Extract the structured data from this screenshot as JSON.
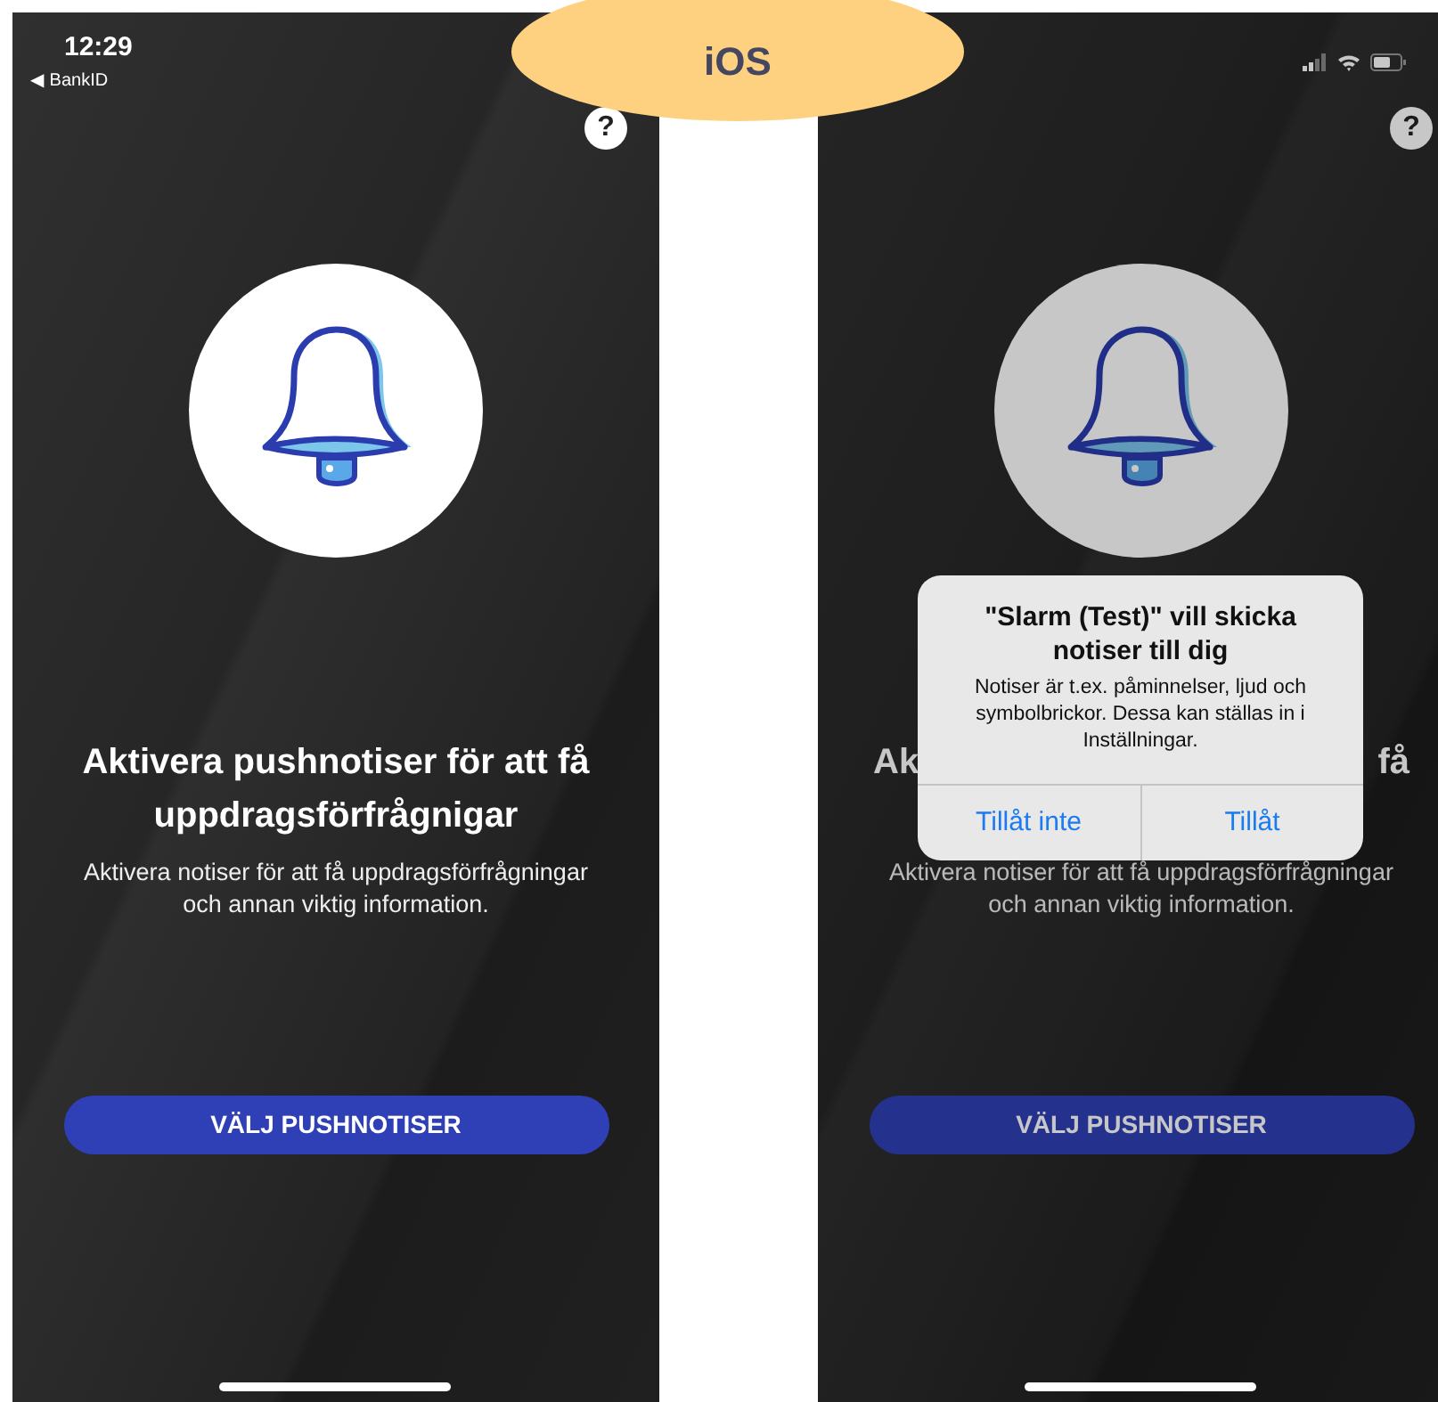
{
  "badge": {
    "label": "iOS"
  },
  "screens": [
    {
      "dimmed": false,
      "status_bar": {
        "time": "12:29",
        "back_link": "◀ BankID",
        "show_icons": false
      },
      "help": "?",
      "title": "Aktivera pushnotiser för att få uppdragsförfrågnigar",
      "body": "Aktivera notiser för att få uppdragsförfrågningar och annan viktig information.",
      "button": "VÄLJ PUSHNOTISER"
    },
    {
      "dimmed": true,
      "status_bar": {
        "show_icons": true
      },
      "help": "?",
      "title_fragments": [
        "Ak",
        "få"
      ],
      "body": "Aktivera notiser för att få uppdragsförfrågningar och annan viktig information.",
      "button": "VÄLJ PUSHNOTISER",
      "alert": {
        "title": "\"Slarm (Test)\" vill skicka notiser till dig",
        "message": "Notiser är t.ex. påminnelser, ljud och symbolbrickor. Dessa kan ställas in i Inställningar.",
        "buttons": [
          "Tillåt inte",
          "Tillåt"
        ]
      }
    }
  ]
}
